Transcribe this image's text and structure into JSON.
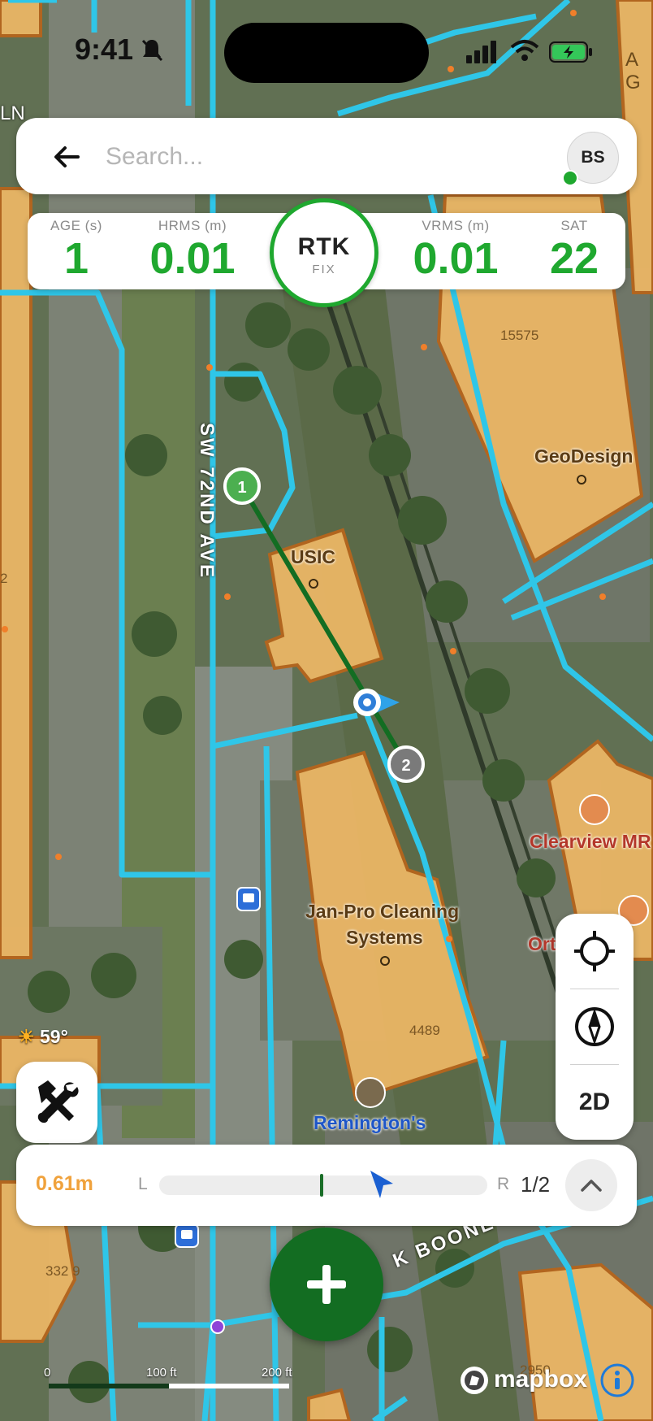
{
  "status_bar": {
    "time": "9:41"
  },
  "search": {
    "placeholder": "Search...",
    "value": "",
    "avatar_initials": "BS"
  },
  "gnss": {
    "age_label": "AGE (s)",
    "age_value": "1",
    "hrms_label": "HRMS (m)",
    "hrms_value": "0.01",
    "fix_title": "RTK",
    "fix_sub": "FIX",
    "vrms_label": "VRMS (m)",
    "vrms_value": "0.01",
    "sat_label": "SAT",
    "sat_value": "22"
  },
  "map_labels": {
    "street": "SW 72ND AVE",
    "usic": "USIC",
    "geodesign": "GeoDesign",
    "address1": "15575",
    "jan_pro_1": "Jan-Pro Cleaning",
    "jan_pro_2": "Systems",
    "address2": "4489",
    "remingtons": "Remington's",
    "clearview": "Clearview MR",
    "ort": "Ort",
    "address3": "332 9",
    "address4": "2950",
    "boone": "K BOONE",
    "ag": "A G",
    "ln": "LN",
    "digit2": "2",
    "point1": "1",
    "point2": "2"
  },
  "weather": {
    "temp": "59°"
  },
  "map_controls": {
    "mode_label": "2D"
  },
  "offset_bar": {
    "distance": "0.61m",
    "left": "L",
    "right": "R",
    "page": "1/2"
  },
  "scale": {
    "zero": "0",
    "mid": "100 ft",
    "end": "200 ft"
  },
  "attribution": {
    "brand": "mapbox"
  },
  "colors": {
    "fix_green": "#1fa82f",
    "fab_green": "#136d22",
    "line_green": "#136d22",
    "utility_cyan": "#2fc6e8",
    "building_fill": "#e9b565",
    "building_stroke": "#b5651d",
    "offset_orange": "#f0a23c"
  }
}
